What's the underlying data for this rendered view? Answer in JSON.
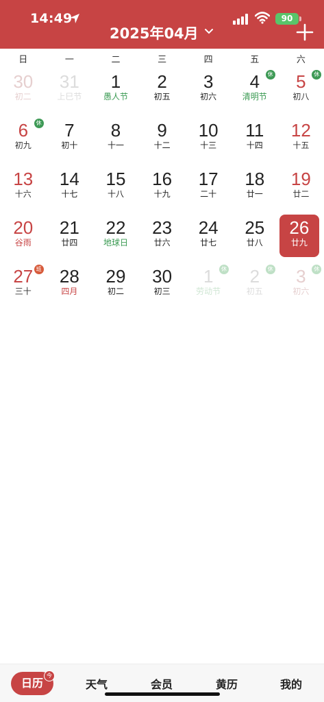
{
  "status": {
    "time": "14:49",
    "battery": "90"
  },
  "header": {
    "month_title": "2025年04月"
  },
  "weekdays": [
    "日",
    "一",
    "二",
    "三",
    "四",
    "五",
    "六"
  ],
  "weeks": [
    [
      {
        "num": "30",
        "sub": "初二",
        "state": "faded"
      },
      {
        "num": "31",
        "sub": "上巳节",
        "state": "faded-gray"
      },
      {
        "num": "1",
        "sub": "愚人节",
        "subColor": "green"
      },
      {
        "num": "2",
        "sub": "初五"
      },
      {
        "num": "3",
        "sub": "初六"
      },
      {
        "num": "4",
        "sub": "清明节",
        "subColor": "green",
        "badge": "休",
        "badgeType": "rest"
      },
      {
        "num": "5",
        "sub": "初八",
        "weekend": true,
        "badge": "休",
        "badgeType": "rest"
      }
    ],
    [
      {
        "num": "6",
        "sub": "初九",
        "weekend": true,
        "badge": "休",
        "badgeType": "rest"
      },
      {
        "num": "7",
        "sub": "初十"
      },
      {
        "num": "8",
        "sub": "十一"
      },
      {
        "num": "9",
        "sub": "十二"
      },
      {
        "num": "10",
        "sub": "十三"
      },
      {
        "num": "11",
        "sub": "十四"
      },
      {
        "num": "12",
        "sub": "十五",
        "weekend": true
      }
    ],
    [
      {
        "num": "13",
        "sub": "十六",
        "weekend": true
      },
      {
        "num": "14",
        "sub": "十七"
      },
      {
        "num": "15",
        "sub": "十八"
      },
      {
        "num": "16",
        "sub": "十九"
      },
      {
        "num": "17",
        "sub": "二十"
      },
      {
        "num": "18",
        "sub": "廿一"
      },
      {
        "num": "19",
        "sub": "廿二",
        "weekend": true
      }
    ],
    [
      {
        "num": "20",
        "sub": "谷雨",
        "weekend": true,
        "subColor": "red"
      },
      {
        "num": "21",
        "sub": "廿四"
      },
      {
        "num": "22",
        "sub": "地球日",
        "subColor": "green"
      },
      {
        "num": "23",
        "sub": "廿六"
      },
      {
        "num": "24",
        "sub": "廿七"
      },
      {
        "num": "25",
        "sub": "廿八"
      },
      {
        "num": "26",
        "sub": "廿九",
        "today": true
      }
    ],
    [
      {
        "num": "27",
        "sub": "三十",
        "weekend": true,
        "badge": "班",
        "badgeType": "work"
      },
      {
        "num": "28",
        "sub": "四月",
        "subColor": "red"
      },
      {
        "num": "29",
        "sub": "初二"
      },
      {
        "num": "30",
        "sub": "初三"
      },
      {
        "num": "1",
        "sub": "劳动节",
        "state": "faded-gray",
        "subColor": "green",
        "badge": "休",
        "badgeType": "faded-rest"
      },
      {
        "num": "2",
        "sub": "初五",
        "state": "faded-gray",
        "badge": "休",
        "badgeType": "faded-rest"
      },
      {
        "num": "3",
        "sub": "初六",
        "state": "faded",
        "badge": "休",
        "badgeType": "faded-rest"
      }
    ]
  ],
  "tabs": {
    "calendar": "日历",
    "today_mark": "今",
    "weather": "天气",
    "member": "会员",
    "almanac": "黄历",
    "mine": "我的"
  },
  "colors": {
    "accent": "#c74444",
    "holiday_green": "#3a9a52",
    "battery": "#59c56a"
  }
}
